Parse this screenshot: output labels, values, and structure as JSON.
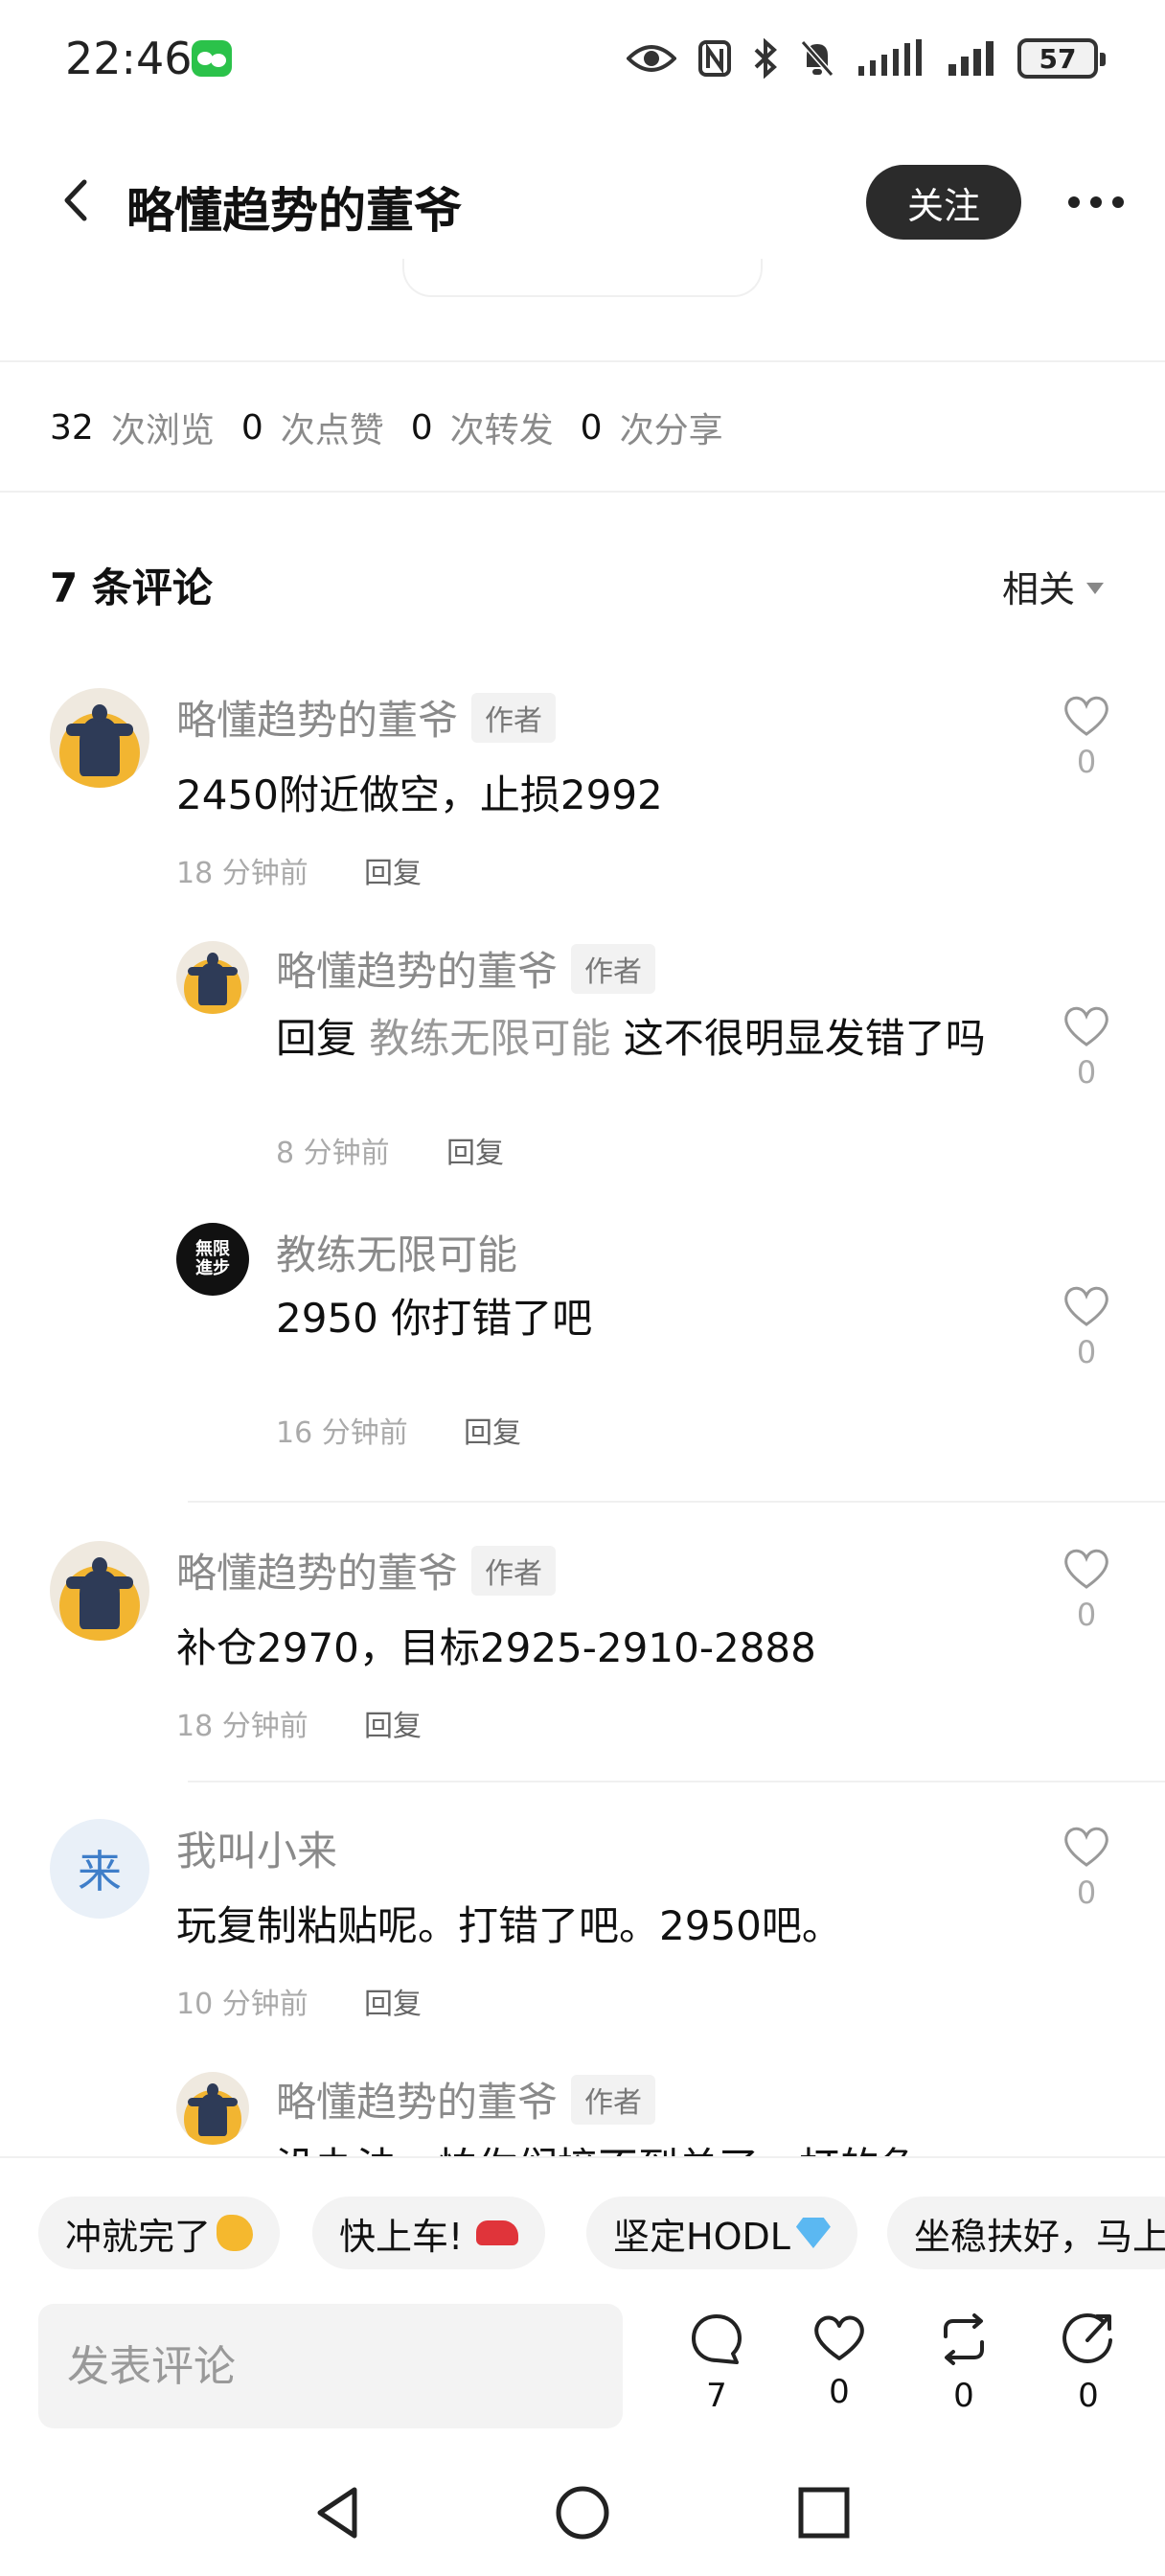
{
  "status_bar": {
    "time": "22:46",
    "battery": "57"
  },
  "header": {
    "title": "略懂趋势的董爷",
    "follow_label": "关注"
  },
  "stats": [
    {
      "value": "32",
      "label": "次浏览"
    },
    {
      "value": "0",
      "label": "次点赞"
    },
    {
      "value": "0",
      "label": "次转发"
    },
    {
      "value": "0",
      "label": "次分享"
    }
  ],
  "comments_header": {
    "title": "7 条评论",
    "sort": "相关"
  },
  "author_badge": "作者",
  "reply_label": "回复",
  "comments": [
    {
      "name": "略懂趋势的董爷",
      "text": "2450附近做空，止损2992",
      "time": "18 分钟前",
      "likes": "0"
    },
    {
      "name": "略懂趋势的董爷",
      "reply_prefix": "回复",
      "mention": "教练无限可能",
      "text": "这不很明显发错了吗",
      "time": "8 分钟前",
      "likes": "0"
    },
    {
      "name": "教练无限可能",
      "text": "2950 你打错了吧",
      "time": "16 分钟前",
      "likes": "0"
    },
    {
      "name": "略懂趋势的董爷",
      "text": "补仓2970，目标2925-2910-2888",
      "time": "18 分钟前",
      "likes": "0"
    },
    {
      "name": "我叫小来",
      "avatar_char": "来",
      "text": "玩复制粘贴呢。打错了吧。2950吧。",
      "time": "10 分钟前",
      "likes": "0"
    },
    {
      "name": "略懂趋势的董爷",
      "text": "没办法，怕你们接不到单了，打的急"
    }
  ],
  "avatar_black_text": "無限\n進步",
  "reactions": [
    "冲就完了",
    "快上车!",
    "坚定HODL",
    "坐稳扶好，马上"
  ],
  "input": {
    "placeholder": "发表评论"
  },
  "actions": {
    "comments": "7",
    "likes": "0",
    "reposts": "0",
    "shares": "0"
  }
}
